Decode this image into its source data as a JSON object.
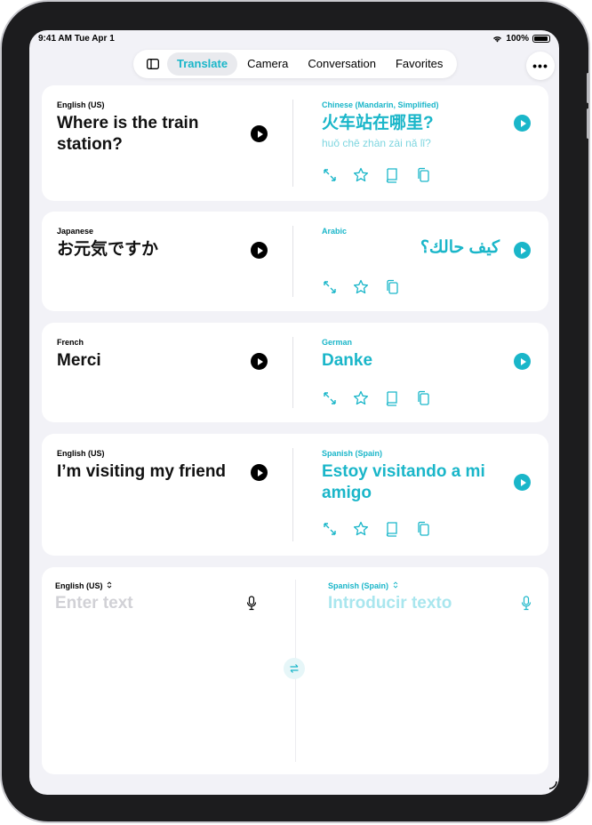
{
  "status_bar": {
    "time": "9:41 AM  Tue Apr 1",
    "battery": "100%"
  },
  "nav": {
    "tabs": [
      {
        "label": "Translate",
        "active": true
      },
      {
        "label": "Camera",
        "active": false
      },
      {
        "label": "Conversation",
        "active": false
      },
      {
        "label": "Favorites",
        "active": false
      }
    ],
    "more_label": "•••"
  },
  "colors": {
    "accent": "#1ab6c9",
    "background": "#f2f2f7"
  },
  "translations": [
    {
      "source_lang": "English (US)",
      "source_text": "Where is the train station?",
      "target_lang": "Chinese (Mandarin, Simplified)",
      "target_text": "火车站在哪里?",
      "romanization": "huǒ chē zhàn zài nǎ lǐ?",
      "actions": [
        "expand-icon",
        "star-icon",
        "book-icon",
        "copy-icon"
      ]
    },
    {
      "source_lang": "Japanese",
      "source_text": "お元気ですか",
      "target_lang": "Arabic",
      "target_text": "كيف حالك؟",
      "actions": [
        "expand-icon",
        "star-icon",
        "copy-icon"
      ]
    },
    {
      "source_lang": "French",
      "source_text": "Merci",
      "target_lang": "German",
      "target_text": "Danke",
      "actions": [
        "expand-icon",
        "star-icon",
        "book-icon",
        "copy-icon"
      ]
    },
    {
      "source_lang": "English (US)",
      "source_text": "I’m visiting my friend",
      "target_lang": "Spanish (Spain)",
      "target_text": "Estoy visitando a mi amigo",
      "actions": [
        "expand-icon",
        "star-icon",
        "book-icon",
        "copy-icon"
      ]
    }
  ],
  "input": {
    "source_lang": "English (US)",
    "source_placeholder": "Enter text",
    "target_lang": "Spanish (Spain)",
    "target_placeholder": "Introducir texto"
  }
}
